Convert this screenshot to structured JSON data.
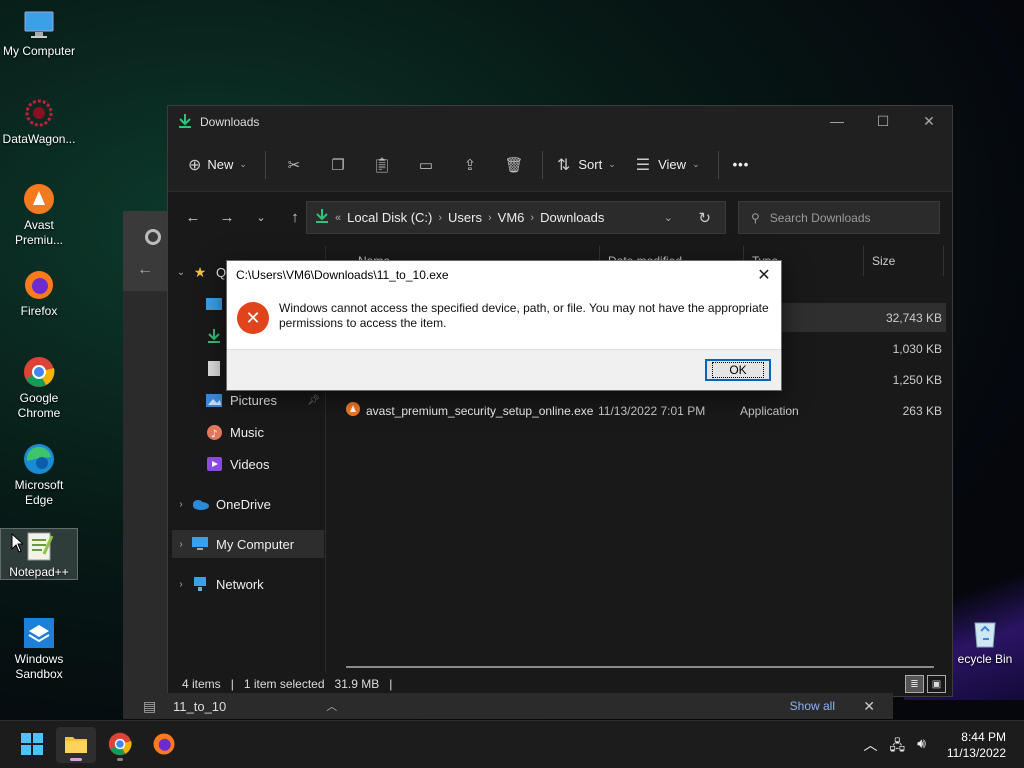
{
  "desktop": {
    "icons": [
      {
        "label": "My Computer",
        "icon": "monitor-icon"
      },
      {
        "label": "DataWagon...",
        "icon": "datawagon-icon"
      },
      {
        "label": "Avast Premiu...",
        "icon": "avast-icon"
      },
      {
        "label": "Firefox",
        "icon": "firefox-icon"
      },
      {
        "label": "Google Chrome",
        "icon": "chrome-icon"
      },
      {
        "label": "Microsoft Edge",
        "icon": "edge-icon"
      },
      {
        "label": "Notepad++",
        "icon": "notepadpp-icon"
      },
      {
        "label": "Windows Sandbox",
        "icon": "sandbox-icon"
      },
      {
        "label": "ecycle Bin",
        "icon": "recycle-bin-icon"
      }
    ]
  },
  "explorer": {
    "title": "Downloads",
    "toolbar": {
      "new_label": "New",
      "sort_label": "Sort",
      "view_label": "View",
      "more_label": "•••"
    },
    "address": {
      "crumbs": [
        "Local Disk (C:)",
        "Users",
        "VM6",
        "Downloads"
      ]
    },
    "search": {
      "placeholder": "Search Downloads"
    },
    "sidebar": {
      "quick_access_label": "Q",
      "pictures": "Pictures",
      "music": "Music",
      "videos": "Videos",
      "onedrive": "OneDrive",
      "my_computer": "My Computer",
      "network": "Network"
    },
    "columns": {
      "name": "Name",
      "date": "Date modified",
      "type": "Type",
      "size": "Size"
    },
    "files": [
      {
        "name": "",
        "date": "",
        "type": "ation",
        "size": "32,743 KB"
      },
      {
        "name": "",
        "date": "",
        "type": "chive",
        "size": "1,030 KB"
      },
      {
        "name": "",
        "date": "",
        "type": "chive",
        "size": "1,250 KB"
      },
      {
        "name": "avast_premium_security_setup_online.exe",
        "date": "11/13/2022 7:01 PM",
        "type": "Application",
        "size": "263 KB"
      }
    ],
    "status": {
      "items": "4 items",
      "selected": "1 item selected",
      "size": "31.9 MB",
      "sep": "|"
    }
  },
  "downloads_bar": {
    "file": "11_to_10",
    "show_all": "Show all"
  },
  "dialog": {
    "title": "C:\\Users\\VM6\\Downloads\\11_to_10.exe",
    "message": "Windows cannot access the specified device, path, or file. You may not have the appropriate permissions to access the item.",
    "ok_label": "OK"
  },
  "taskbar": {
    "time": "8:44 PM",
    "date": "11/13/2022"
  },
  "colors": {
    "accent": "#0067c0",
    "error": "#e1431b",
    "folder": "#f3c13a"
  }
}
